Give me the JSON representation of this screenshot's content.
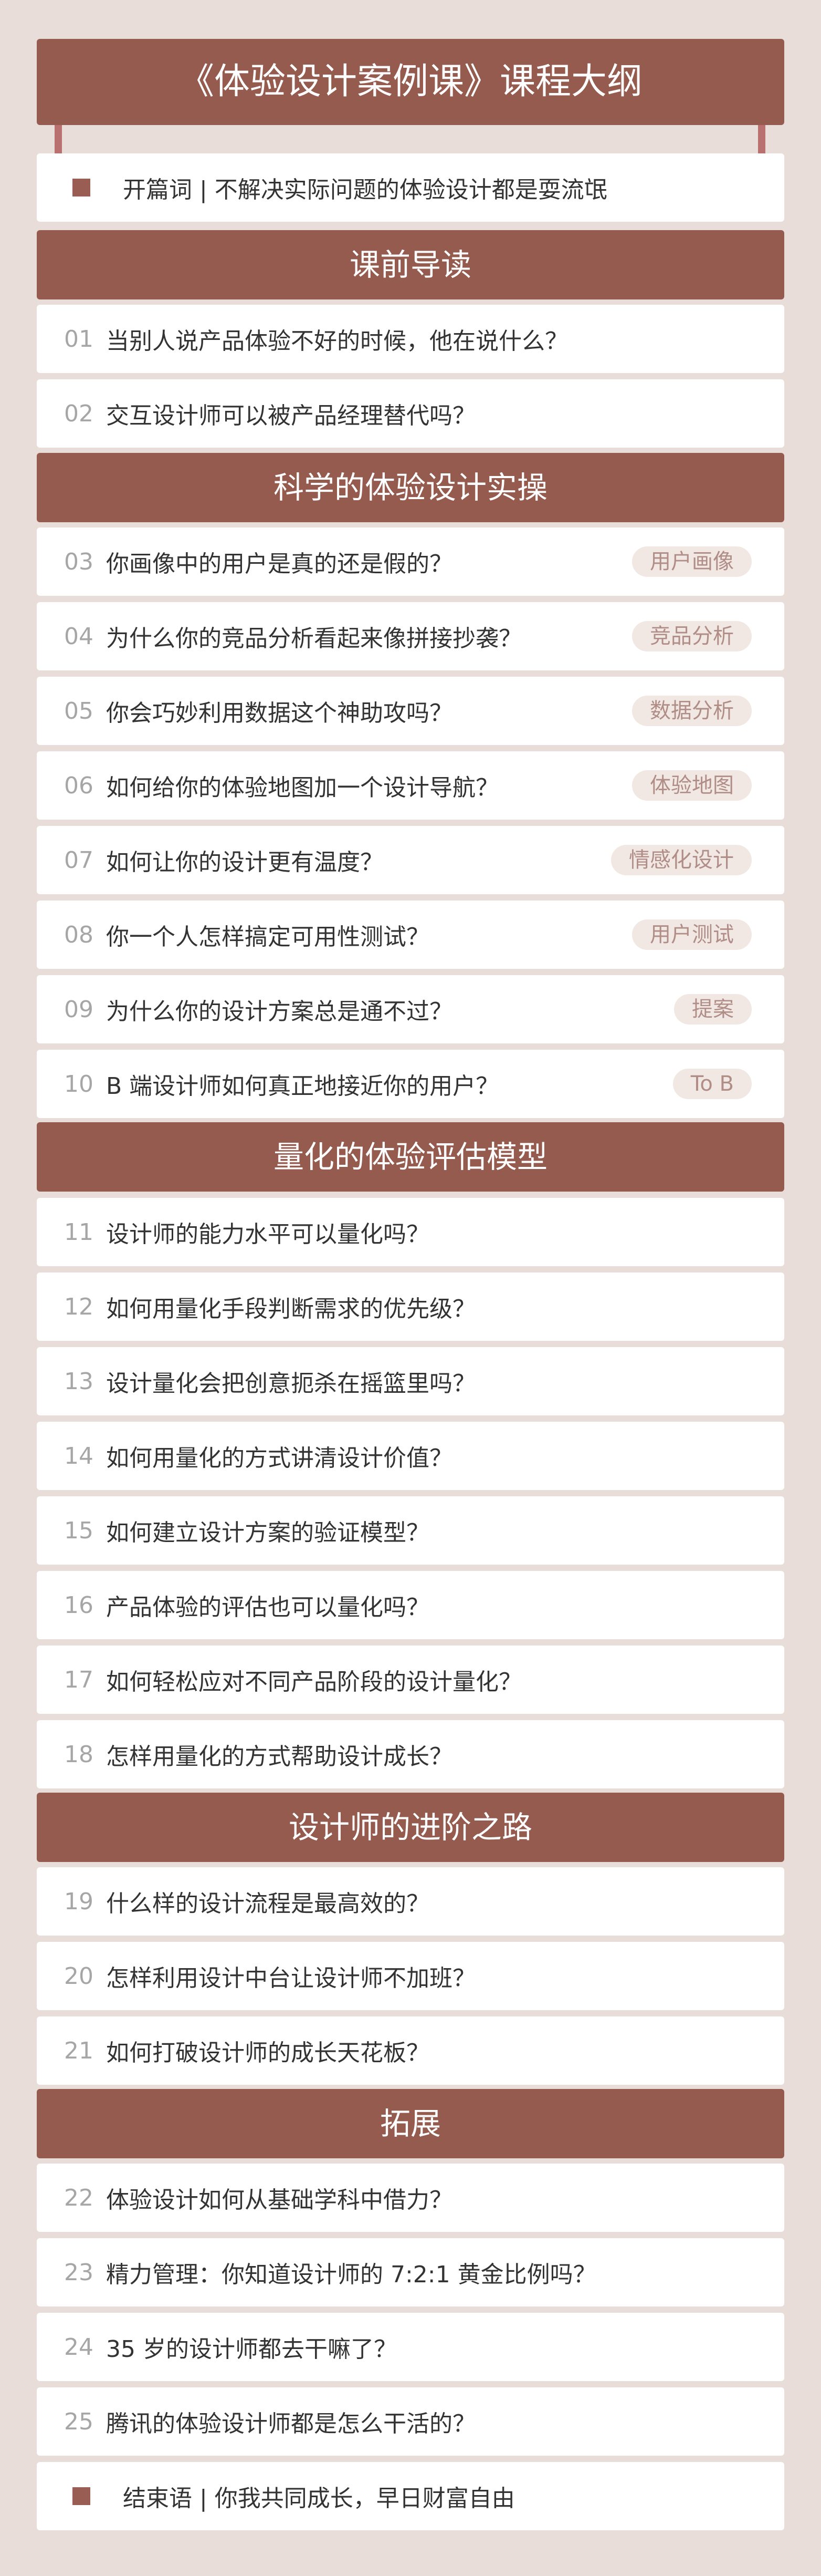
{
  "title": "《体验设计案例课》课程大纲",
  "intro": {
    "text": "开篇词 | 不解决实际问题的体验设计都是耍流氓"
  },
  "sections": [
    {
      "title": "课前导读",
      "items": [
        {
          "num": "01",
          "text": "当别人说产品体验不好的时候，他在说什么？"
        },
        {
          "num": "02",
          "text": "交互设计师可以被产品经理替代吗？"
        }
      ]
    },
    {
      "title": "科学的体验设计实操",
      "items": [
        {
          "num": "03",
          "text": "你画像中的用户是真的还是假的？",
          "tag": "用户画像"
        },
        {
          "num": "04",
          "text": "为什么你的竞品分析看起来像拼接抄袭？",
          "tag": "竞品分析"
        },
        {
          "num": "05",
          "text": "你会巧妙利用数据这个神助攻吗？",
          "tag": "数据分析"
        },
        {
          "num": "06",
          "text": "如何给你的体验地图加一个设计导航？",
          "tag": "体验地图"
        },
        {
          "num": "07",
          "text": "如何让你的设计更有温度？",
          "tag": "情感化设计"
        },
        {
          "num": "08",
          "text": "你一个人怎样搞定可用性测试？",
          "tag": "用户测试"
        },
        {
          "num": "09",
          "text": "为什么你的设计方案总是通不过？",
          "tag": "提案"
        },
        {
          "num": "10",
          "text": "B 端设计师如何真正地接近你的用户？",
          "tag": "To B"
        }
      ]
    },
    {
      "title": "量化的体验评估模型",
      "items": [
        {
          "num": "11",
          "text": "设计师的能力水平可以量化吗？"
        },
        {
          "num": "12",
          "text": "如何用量化手段判断需求的优先级？"
        },
        {
          "num": "13",
          "text": "设计量化会把创意扼杀在摇篮里吗？"
        },
        {
          "num": "14",
          "text": "如何用量化的方式讲清设计价值？"
        },
        {
          "num": "15",
          "text": "如何建立设计方案的验证模型？"
        },
        {
          "num": "16",
          "text": "产品体验的评估也可以量化吗？"
        },
        {
          "num": "17",
          "text": "如何轻松应对不同产品阶段的设计量化？"
        },
        {
          "num": "18",
          "text": "怎样用量化的方式帮助设计成长？"
        }
      ]
    },
    {
      "title": "设计师的进阶之路",
      "items": [
        {
          "num": "19",
          "text": "什么样的设计流程是最高效的？"
        },
        {
          "num": "20",
          "text": "怎样利用设计中台让设计师不加班？"
        },
        {
          "num": "21",
          "text": "如何打破设计师的成长天花板？"
        }
      ]
    },
    {
      "title": "拓展",
      "items": [
        {
          "num": "22",
          "text": "体验设计如何从基础学科中借力？"
        },
        {
          "num": "23",
          "text": "精力管理：你知道设计师的 7:2:1 黄金比例吗？"
        },
        {
          "num": "24",
          "text": "35 岁的设计师都去干嘛了？"
        },
        {
          "num": "25",
          "text": "腾讯的体验设计师都是怎么干活的？"
        }
      ]
    }
  ],
  "outro": {
    "text": "结束语 | 你我共同成长，早日财富自由"
  },
  "colors": {
    "background": "#e8ddd8",
    "accent": "#955b4e",
    "tag_bg": "#f1e7e3",
    "tag_text": "#b08d87"
  }
}
